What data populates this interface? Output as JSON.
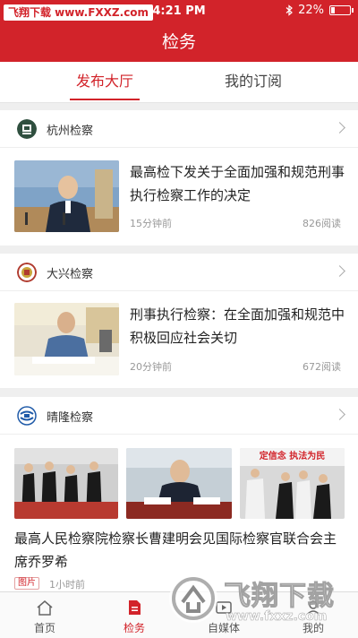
{
  "status": {
    "watermark": "飞翔下载 www.FXXZ.com",
    "time": "4:21 PM",
    "battery": "22%"
  },
  "header": {
    "title": "检务"
  },
  "tabs": [
    {
      "label": "发布大厅"
    },
    {
      "label": "我的订阅"
    }
  ],
  "feed": [
    {
      "source": "杭州检察",
      "title": "最高检下发关于全面加强和规范刑事执行检察工作的决定",
      "time": "15分钟前",
      "reads": "826阅读"
    },
    {
      "source": "大兴检察",
      "title": "刑事执行检察：在全面加强和规范中积极回应社会关切",
      "time": "20分钟前",
      "reads": "672阅读"
    },
    {
      "source": "晴隆检察",
      "title": "最高人民检察院检察长曹建明会见国际检察官联合会主席乔罗希",
      "tag": "图片",
      "time": "1小时前",
      "banner": "定信念 执法为民"
    }
  ],
  "tabbar": [
    {
      "label": "首页"
    },
    {
      "label": "检务"
    },
    {
      "label": "自媒体"
    },
    {
      "label": "我的"
    }
  ],
  "watermark_logo": {
    "text": "飞翔下载",
    "url": "www.fxxz.com"
  },
  "colors": {
    "brand": "#d2232a"
  }
}
